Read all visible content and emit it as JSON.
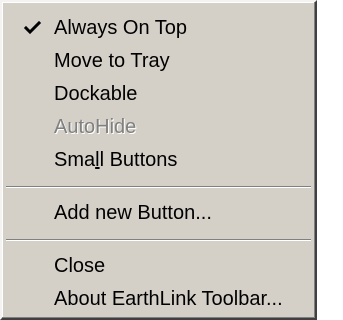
{
  "menu": {
    "items": [
      {
        "label": "Always On Top",
        "checked": true,
        "enabled": true
      },
      {
        "label": "Move to Tray",
        "checked": false,
        "enabled": true
      },
      {
        "label": "Dockable",
        "checked": false,
        "enabled": true
      },
      {
        "label": "AutoHide",
        "checked": false,
        "enabled": false
      },
      {
        "label_pre": "Sma",
        "label_mnemonic": "l",
        "label_post": "l Buttons",
        "checked": false,
        "enabled": true
      },
      {
        "label": "Add new Button...",
        "checked": false,
        "enabled": true
      },
      {
        "label": "Close",
        "checked": false,
        "enabled": true
      },
      {
        "label": "About EarthLink Toolbar...",
        "checked": false,
        "enabled": true
      }
    ],
    "check_icon": "checkmark-icon"
  }
}
